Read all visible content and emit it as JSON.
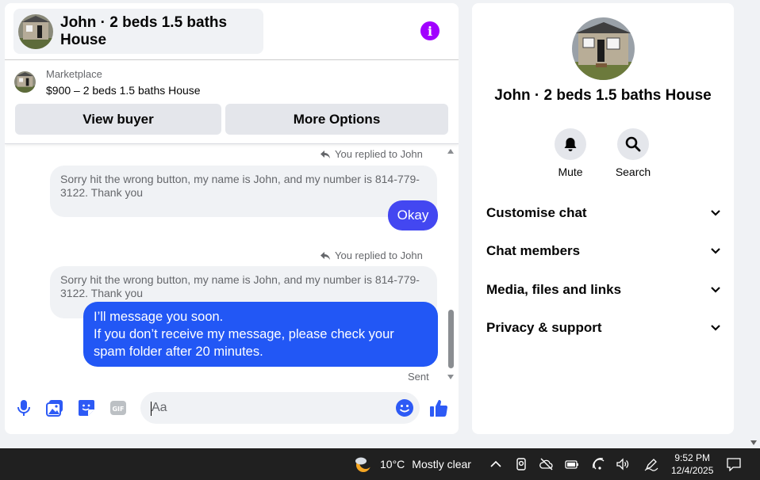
{
  "header": {
    "title": "John · 2 beds 1.5 baths House",
    "info_icon": "info-icon",
    "accent": "#a100ff"
  },
  "marketplace": {
    "label": "Marketplace",
    "listing": "$900 – 2 beds 1.5 baths House",
    "view_buyer": "View buyer",
    "more_options": "More Options"
  },
  "messages": {
    "replied_1": "You replied to John",
    "quote_1": "Sorry hit the wrong button, my name is John, and my number is 814-779-3122. Thank you",
    "reply_1": "Okay",
    "replied_2": "You replied to John",
    "quote_2": "Sorry hit the wrong button, my name is John, and my number is 814-779-3122. Thank you",
    "reply_2_line1": "I’ll message you soon.",
    "reply_2_line2": "If you don’t receive my message, please check your spam folder after 20 minutes.",
    "status": "Sent",
    "bubble_color": "#2257f5"
  },
  "composer": {
    "placeholder": "Aa",
    "icons": [
      "microphone-icon",
      "gallery-icon",
      "sticker-icon",
      "gif-icon",
      "emoji-icon",
      "thumbs-up-icon"
    ]
  },
  "side": {
    "title": "John · 2 beds 1.5 baths House",
    "mute": "Mute",
    "search": "Search",
    "sections": [
      "Customise chat",
      "Chat members",
      "Media, files and links",
      "Privacy & support"
    ]
  },
  "taskbar": {
    "temperature": "10°C",
    "weather": "Mostly clear",
    "time": "9:52 PM",
    "date": "12/4/2025"
  }
}
